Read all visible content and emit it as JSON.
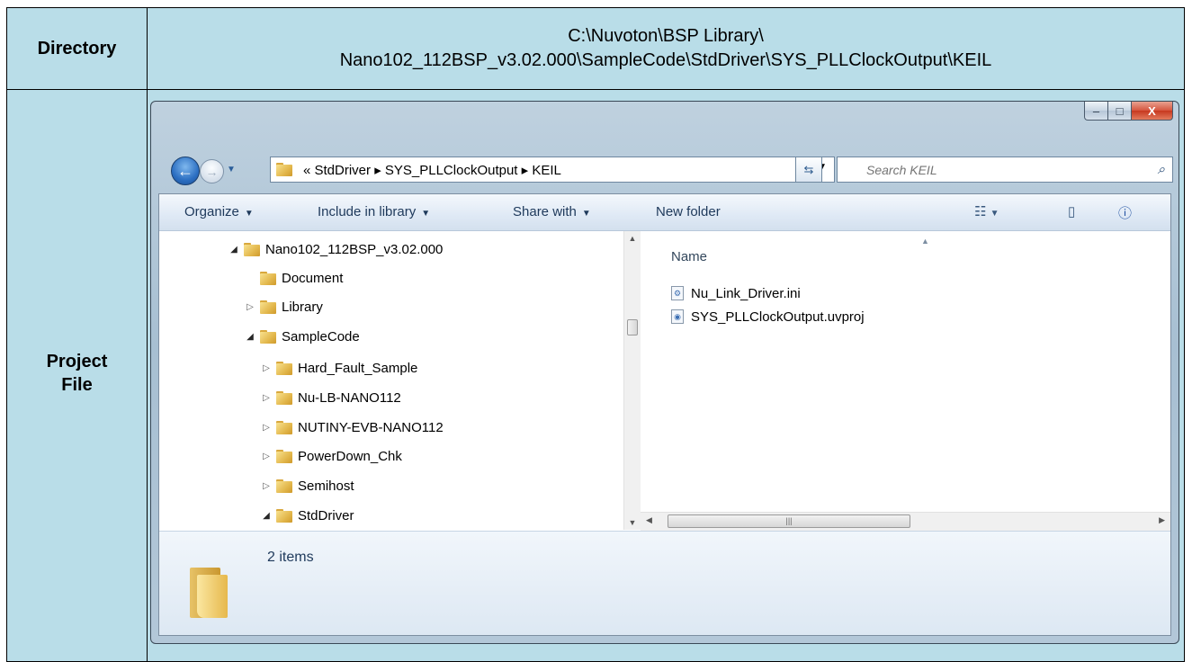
{
  "table": {
    "directory_label": "Directory",
    "directory_line1": "C:\\Nuvoton\\BSP Library\\",
    "directory_line2": "Nano102_112BSP_v3.02.000\\SampleCode\\StdDriver\\SYS_PLLClockOutput\\KEIL",
    "project_label_line1": "Project",
    "project_label_line2": "File"
  },
  "window": {
    "caption_min": "–",
    "caption_max": "□",
    "caption_close": "X",
    "address": "«  StdDriver  ▸  SYS_PLLClockOutput  ▸  KEIL",
    "search_placeholder": "Search KEIL"
  },
  "commands": {
    "organize": "Organize",
    "include": "Include in library",
    "share": "Share with",
    "new_folder": "New folder"
  },
  "tree": [
    {
      "label": "Nano102_112BSP_v3.02.000",
      "state": "open"
    },
    {
      "label": "Document",
      "state": "none"
    },
    {
      "label": "Library",
      "state": "closed"
    },
    {
      "label": "SampleCode",
      "state": "open"
    },
    {
      "label": "Hard_Fault_Sample",
      "state": "closed"
    },
    {
      "label": "Nu-LB-NANO112",
      "state": "closed"
    },
    {
      "label": "NUTINY-EVB-NANO112",
      "state": "closed"
    },
    {
      "label": "PowerDown_Chk",
      "state": "closed"
    },
    {
      "label": "Semihost",
      "state": "closed"
    },
    {
      "label": "StdDriver",
      "state": "open"
    }
  ],
  "list": {
    "column_name": "Name",
    "files": [
      {
        "name": "Nu_Link_Driver.ini",
        "icon": "ini-file-icon"
      },
      {
        "name": "SYS_PLLClockOutput.uvproj",
        "icon": "uvproj-file-icon"
      }
    ]
  },
  "details": {
    "items_count": "2 items"
  }
}
